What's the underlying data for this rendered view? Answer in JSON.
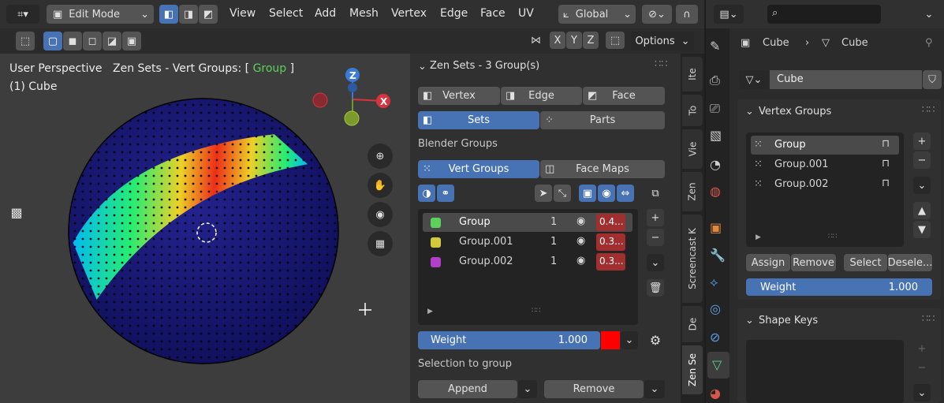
{
  "header": {
    "mode_label": "Edit Mode",
    "menus": [
      "View",
      "Select",
      "Add",
      "Mesh",
      "Vertex",
      "Edge",
      "Face",
      "UV"
    ],
    "transform_orientation": "Global",
    "axes": [
      "X",
      "Y",
      "Z"
    ],
    "options_label": "Options"
  },
  "viewport": {
    "view_name": "User Perspective",
    "object_line": "(1) Cube",
    "zen_prefix": "Zen Sets - Vert Groups: [ ",
    "zen_group": "Group",
    "zen_suffix": " ]",
    "gizmo_z": "Z",
    "gizmo_x": "X"
  },
  "zen_panel": {
    "title": "Zen Sets - 3 Group(s)",
    "modes": [
      "Vertex",
      "Edge",
      "Face"
    ],
    "sets_label": "Sets",
    "parts_label": "Parts",
    "blender_groups_label": "Blender Groups",
    "vert_groups_label": "Vert Groups",
    "face_maps_label": "Face Maps",
    "groups": [
      {
        "name": "Group",
        "count": "1",
        "value": "0.4...",
        "color": "#5bd15b"
      },
      {
        "name": "Group.001",
        "count": "1",
        "value": "0.3...",
        "color": "#d1cb3b"
      },
      {
        "name": "Group.002",
        "count": "1",
        "value": "0.3...",
        "color": "#b23fc7"
      }
    ],
    "weight_label": "Weight",
    "weight_value": "1.000",
    "weight_color": "#ff0000",
    "selection_to_group_label": "Selection to group",
    "append_label": "Append",
    "remove_label": "Remove"
  },
  "side_tabs": [
    "Ite",
    "To",
    "Vie",
    "Zen",
    "Screencast K",
    "De",
    "Zen Se"
  ],
  "properties": {
    "breadcrumb_object": "Cube",
    "breadcrumb_mesh": "Cube",
    "mesh_name": "Cube",
    "vertex_groups_title": "Vertex Groups",
    "vertex_groups": [
      "Group",
      "Group.001",
      "Group.002"
    ],
    "assign_label": "Assign",
    "remove_label": "Remove",
    "select_label": "Select",
    "deselect_label": "Desele...",
    "weight_label": "Weight",
    "weight_value": "1.000",
    "shape_keys_title": "Shape Keys"
  },
  "colors": {
    "accent": "#4772b3",
    "active_row": "#4a4a4a",
    "value_red": "#a12f2f"
  }
}
